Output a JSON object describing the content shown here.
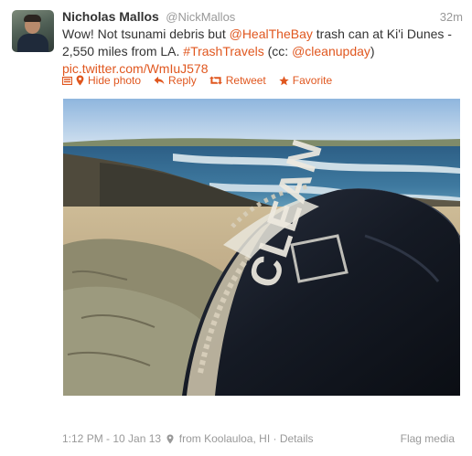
{
  "tweet": {
    "fullname": "Nicholas Mallos",
    "username": "@NickMallos",
    "time": "32m",
    "text": {
      "t1": "Wow! Not tsunami debris but ",
      "mention1": "@HealTheBay",
      "t2": " trash can at Ki'i Dunes - 2,550 miles from LA. ",
      "hashtag": "#TrashTravels",
      "t3": " (cc: ",
      "mention2": "@cleanupday",
      "t4": ")",
      "link": "pic.twitter.com/WmIuJ578"
    },
    "actions": {
      "hide_photo": "Hide photo",
      "reply": "Reply",
      "retweet": "Retweet",
      "favorite": "Favorite"
    },
    "photo": {
      "can_text": "CLEAN"
    },
    "footer": {
      "timestamp": "1:12 PM - 10 Jan 13",
      "location": "from Koolauloa, HI",
      "separator": "·",
      "details": "Details",
      "flag_media": "Flag media"
    },
    "colors": {
      "link": "#e0571f",
      "muted": "#999999",
      "text": "#333333"
    },
    "icons": [
      "photo-icon",
      "location-pin-icon",
      "reply-icon",
      "retweet-icon",
      "favorite-star-icon"
    ]
  }
}
